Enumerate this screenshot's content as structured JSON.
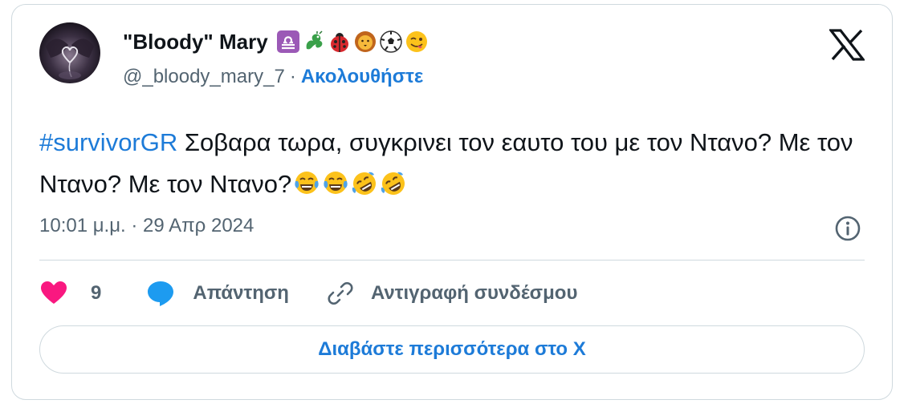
{
  "author": {
    "display_name": "\"Bloody\" Mary",
    "handle": "@_bloody_mary_7",
    "separator": "·",
    "follow_label": "Ακολουθήστε",
    "name_emojis": [
      "libra-icon",
      "dragon-icon",
      "ladybug-icon",
      "lion-icon",
      "soccer-ball-icon",
      "winking-tongue-face-icon"
    ]
  },
  "tweet": {
    "hashtag": "#survivorGR",
    "text": " Σοβαρα τωρα, συγκρινει τον εαυτο του με τον Ντανο? Με τον Ντανο? Με τον Ντανο?",
    "trailing_emojis": [
      "tears-of-joy-icon",
      "tears-of-joy-icon",
      "rolling-laughing-icon",
      "rolling-laughing-icon"
    ],
    "timestamp": "10:01 μ.μ. · 29 Απρ 2024"
  },
  "actions": {
    "like_count": "9",
    "reply_label": "Απάντηση",
    "copy_link_label": "Αντιγραφή συνδέσμου"
  },
  "read_more_label": "Διαβάστε περισσότερα στο X",
  "colors": {
    "accent": "#1d7bd8",
    "heart": "#f91880",
    "secondary_text": "#536471",
    "border": "#cfd9de"
  }
}
